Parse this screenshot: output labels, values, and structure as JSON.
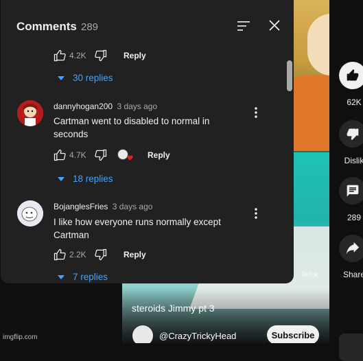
{
  "video": {
    "title": "steroids Jimmy pt 3",
    "watermark_text": "TikTok",
    "channel": "@CrazyTrickyHead",
    "subscribe_label": "Subscribe"
  },
  "rail": {
    "like_count": "62K",
    "dislike_label": "Dislik",
    "comment_count": "289",
    "share_label": "Share"
  },
  "comments_panel": {
    "title": "Comments",
    "count": "289",
    "top_partial": {
      "like_count": "4.2K",
      "reply_label": "Reply",
      "replies": "30 replies"
    },
    "comments": [
      {
        "username": "dannyhogan200",
        "time": "3 days ago",
        "text": "Cartman went to disabled to normal in seconds",
        "like_count": "4.7K",
        "reply_label": "Reply",
        "replies": "18 replies"
      },
      {
        "username": "BojanglesFries",
        "time": "3 days ago",
        "text": "I like how everyone runs normally except Cartman",
        "like_count": "2.2K",
        "reply_label": "Reply",
        "replies": "7 replies"
      }
    ]
  },
  "footer": {
    "imgflip": "imgflip.com"
  }
}
